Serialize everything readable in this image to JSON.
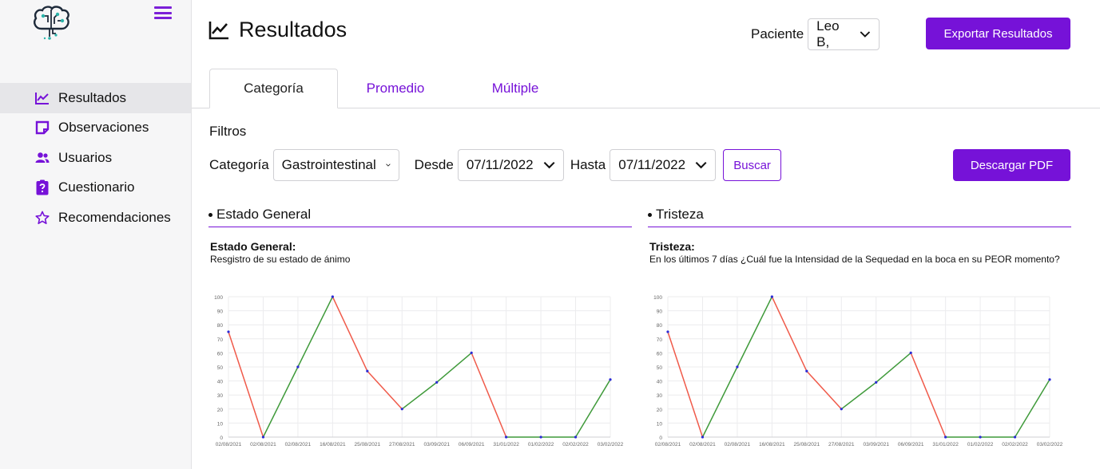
{
  "sidebar": {
    "items": [
      {
        "label": "Resultados",
        "icon": "chart-line-icon",
        "active": true
      },
      {
        "label": "Observaciones",
        "icon": "note-icon",
        "active": false
      },
      {
        "label": "Usuarios",
        "icon": "users-icon",
        "active": false
      },
      {
        "label": "Cuestionario",
        "icon": "clipboard-question-icon",
        "active": false
      },
      {
        "label": "Recomendaciones",
        "icon": "star-icon",
        "active": false
      }
    ]
  },
  "header": {
    "title": "Resultados",
    "patient_label": "Paciente",
    "patient_value": "Leo B,",
    "export_label": "Exportar Resultados"
  },
  "tabs": [
    {
      "label": "Categoría",
      "active": true
    },
    {
      "label": "Promedio",
      "active": false
    },
    {
      "label": "Múltiple",
      "active": false
    }
  ],
  "filters": {
    "title": "Filtros",
    "category_label": "Categoría",
    "category_value": "Gastrointestinal",
    "from_label": "Desde",
    "from_value": "07/11/2022",
    "to_label": "Hasta",
    "to_value": "07/11/2022",
    "search_label": "Buscar",
    "pdf_label": "Descargar PDF"
  },
  "colors": {
    "accent": "#7612d8",
    "line_down": "#f05a4a",
    "line_up": "#3f9a3a",
    "point": "#2b2bd6"
  },
  "chart_data": [
    {
      "type": "line",
      "panel_title": "Estado General",
      "title": "Estado General:",
      "subtitle": "Resgistro de su estado de ánimo",
      "categories": [
        "02/08/2021",
        "02/08/2021",
        "02/08/2021",
        "16/08/2021",
        "25/08/2021",
        "27/08/2021",
        "03/09/2021",
        "06/09/2021",
        "31/01/2022",
        "01/02/2022",
        "02/02/2022",
        "03/02/2022"
      ],
      "values": [
        75,
        0,
        50,
        100,
        47,
        20,
        39,
        60,
        0,
        0,
        0,
        41
      ],
      "yticks": [
        "0",
        "10",
        "20",
        "30",
        "40",
        "50",
        "60",
        "70",
        "80",
        "90",
        "100"
      ],
      "ylim": [
        0,
        100
      ],
      "grid": true
    },
    {
      "type": "line",
      "panel_title": "Tristeza",
      "title": "Tristeza:",
      "subtitle": "En los últimos 7 días ¿Cuál fue la Intensidad de la Sequedad en la boca en su PEOR momento?",
      "categories": [
        "02/08/2021",
        "02/08/2021",
        "02/08/2021",
        "16/08/2021",
        "25/08/2021",
        "27/08/2021",
        "03/09/2021",
        "06/09/2021",
        "31/01/2022",
        "01/02/2022",
        "02/02/2022",
        "03/02/2022"
      ],
      "values": [
        75,
        0,
        50,
        100,
        47,
        20,
        39,
        60,
        0,
        0,
        0,
        41
      ],
      "yticks": [
        "0",
        "10",
        "20",
        "30",
        "40",
        "50",
        "60",
        "70",
        "80",
        "90",
        "100"
      ],
      "ylim": [
        0,
        100
      ],
      "grid": true
    }
  ]
}
